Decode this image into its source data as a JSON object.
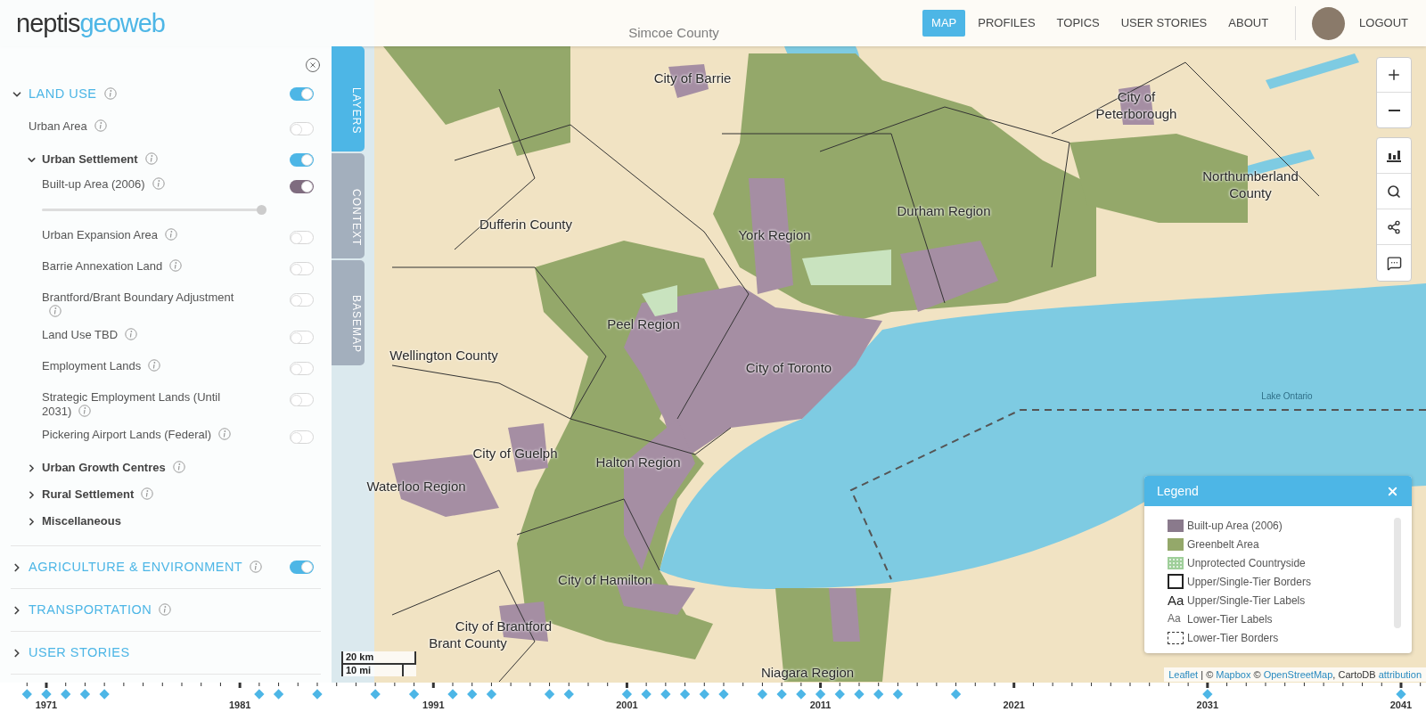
{
  "header": {
    "logo": {
      "part_1": "neptis",
      "part_2": "geoweb"
    },
    "nav": [
      {
        "label": "MAP",
        "selected": true
      },
      {
        "label": "PROFILES",
        "selected": false
      },
      {
        "label": "TOPICS",
        "selected": false
      },
      {
        "label": "USER STORIES",
        "selected": false
      },
      {
        "label": "ABOUT",
        "selected": false
      }
    ],
    "logout": "LOGOUT"
  },
  "side_tabs": [
    {
      "label": "LAYERS",
      "selected": true
    },
    {
      "label": "CONTEXT",
      "selected": false
    },
    {
      "label": "BASEMAP",
      "selected": false
    }
  ],
  "layers": [
    {
      "label": "LAND USE",
      "info": true,
      "expanded": true,
      "on": true,
      "children": [
        {
          "kind": "layer",
          "label": "Urban Area",
          "info": true,
          "on": false
        },
        {
          "kind": "group",
          "label": "Urban Settlement",
          "info": true,
          "expanded": true,
          "on": true,
          "children": [
            {
              "kind": "layer",
              "label": "Built-up Area (2006)",
              "info": true,
              "on": true,
              "color": "#7f6c7f",
              "opacity": {
                "level": 0.98
              }
            },
            {
              "kind": "layer",
              "label": "Urban Expansion Area",
              "info": true,
              "on": false
            },
            {
              "kind": "layer",
              "label": "Barrie Annexation Land",
              "info": true,
              "on": false
            },
            {
              "kind": "layer",
              "label": "Brantford/Brant Boundary Adjustment",
              "info": true,
              "on": false
            },
            {
              "kind": "layer",
              "label": "Land Use TBD",
              "info": true,
              "on": false
            },
            {
              "kind": "layer",
              "label": "Employment Lands",
              "info": true,
              "on": false
            },
            {
              "kind": "layer",
              "label": "Strategic Employment Lands (Until 2031)",
              "info": true,
              "on": false
            },
            {
              "kind": "layer",
              "label": "Pickering Airport Lands (Federal)",
              "info": true,
              "on": false
            }
          ]
        },
        {
          "kind": "group",
          "label": "Urban Growth Centres",
          "info": true,
          "expanded": false
        },
        {
          "kind": "group",
          "label": "Rural Settlement",
          "info": true,
          "expanded": false
        },
        {
          "kind": "group",
          "label": "Miscellaneous",
          "info": false,
          "expanded": false
        }
      ]
    },
    {
      "label": "AGRICULTURE & ENVIRONMENT",
      "info": true,
      "expanded": false,
      "on": true
    },
    {
      "label": "TRANSPORTATION",
      "info": true,
      "expanded": false
    },
    {
      "label": "USER STORIES",
      "info": false,
      "expanded": false
    }
  ],
  "map": {
    "labels": [
      {
        "text": "Simcoe County",
        "kind": "faint"
      },
      {
        "text": "City of Barrie",
        "kind": "major"
      },
      {
        "text": "City of Peterborough",
        "kind": "major"
      },
      {
        "text": "Northumberland County",
        "kind": "major"
      },
      {
        "text": "Dufferin County",
        "kind": "major"
      },
      {
        "text": "York Region",
        "kind": "major"
      },
      {
        "text": "Durham Region",
        "kind": "major"
      },
      {
        "text": "Peel Region",
        "kind": "major"
      },
      {
        "text": "Wellington County",
        "kind": "major"
      },
      {
        "text": "City of Toronto",
        "kind": "major"
      },
      {
        "text": "Lake Ontario",
        "kind": "minor"
      },
      {
        "text": "City of Guelph",
        "kind": "major"
      },
      {
        "text": "Halton Region",
        "kind": "major"
      },
      {
        "text": "Waterloo Region",
        "kind": "major"
      },
      {
        "text": "City of Hamilton",
        "kind": "major"
      },
      {
        "text": "City of Brantford",
        "kind": "major"
      },
      {
        "text": "Brant County",
        "kind": "major"
      },
      {
        "text": "Niagara Region",
        "kind": "major"
      }
    ],
    "scale": [
      "20 km",
      "10 mi"
    ],
    "attribution": [
      {
        "text": "Leaflet",
        "link": true
      },
      {
        "text": " | © ",
        "link": false
      },
      {
        "text": "Mapbox",
        "link": true
      },
      {
        "text": " © ",
        "link": false
      },
      {
        "text": "OpenStreetMap",
        "link": true
      },
      {
        "text": ", CartoDB ",
        "link": false
      },
      {
        "text": "attribution",
        "link": true
      }
    ]
  },
  "legend": {
    "title": "Legend",
    "items": [
      {
        "kind": "fill",
        "color": "#8a7a8c",
        "label": "Built-up Area (2006)"
      },
      {
        "kind": "fill",
        "color": "#94a86a",
        "label": "Greenbelt Area"
      },
      {
        "kind": "dots",
        "color": "#9fcf9a",
        "label": "Unprotected Countryside"
      },
      {
        "kind": "border",
        "label": "Upper/Single-Tier Borders"
      },
      {
        "kind": "text_large",
        "symbol": "Aa",
        "label": "Upper/Single-Tier Labels"
      },
      {
        "kind": "text_small",
        "symbol": "Aa",
        "label": "Lower-Tier Labels"
      },
      {
        "kind": "dashed",
        "label": "Lower-Tier Borders"
      }
    ]
  },
  "timeline": {
    "years": [
      "1971",
      "1981",
      "1991",
      "2001",
      "2011",
      "2021",
      "2031",
      "2041"
    ]
  }
}
